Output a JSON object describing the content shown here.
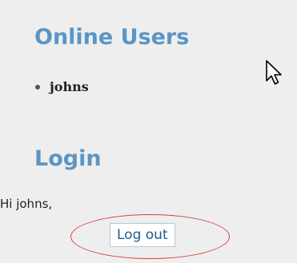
{
  "online_users": {
    "title": "Online Users",
    "users": [
      "johns"
    ]
  },
  "login": {
    "title": "Login",
    "greeting": "Hi johns,",
    "logout_label": "Log out"
  },
  "colors": {
    "heading": "#5b95c4",
    "highlight": "#d94040",
    "background": "#eeeeee"
  },
  "icons": {
    "cursor": "mouse-pointer-icon",
    "bullet": "bullet-icon"
  }
}
